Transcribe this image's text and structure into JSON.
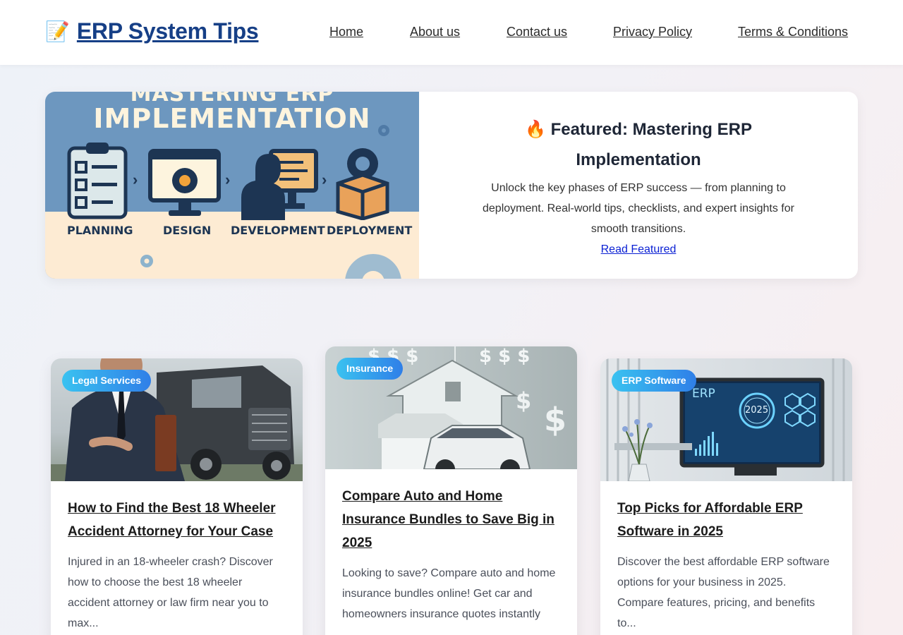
{
  "header": {
    "logo_icon": "📝",
    "logo_text": "ERP System Tips",
    "nav": [
      {
        "label": "Home"
      },
      {
        "label": "About us"
      },
      {
        "label": "Contact us"
      },
      {
        "label": "Privacy Policy"
      },
      {
        "label": "Terms & Conditions"
      }
    ]
  },
  "featured": {
    "image": {
      "heading_top": "MASTERING ERP",
      "heading_main": "IMPLEMENTATION",
      "phases": [
        "PLANNING",
        "DESIGN",
        "DEVELOPMENT",
        "DEPLOYMENT"
      ]
    },
    "title": "🔥 Featured: Mastering ERP Implementation",
    "description": "Unlock the key phases of ERP success — from planning to deployment. Real-world tips, checklists, and expert insights for smooth transitions.",
    "link": "Read Featured"
  },
  "cards": [
    {
      "category": "Legal Services",
      "title": "How to Find the Best 18 Wheeler Accident Attorney for Your Case",
      "excerpt": "Injured in an 18-wheeler crash? Discover how to choose the best 18 wheeler accident attorney or law firm near you to max..."
    },
    {
      "category": "Insurance",
      "title": "Compare Auto and Home Insurance Bundles to Save Big in 2025",
      "excerpt": "Looking to save? Compare auto and home insurance bundles online! Get car and homeowners insurance quotes instantly"
    },
    {
      "category": "ERP Software",
      "title": "Top Picks for Affordable ERP Software in 2025",
      "excerpt": "Discover the best affordable ERP software options for your business in 2025. Compare features, pricing, and benefits to...",
      "image_text": {
        "erp": "ERP",
        "year": "2025"
      }
    }
  ],
  "colors": {
    "brand": "#163f86",
    "badge_start": "#3ac2f0",
    "badge_end": "#2f7fe8",
    "link": "#0b21d4"
  }
}
